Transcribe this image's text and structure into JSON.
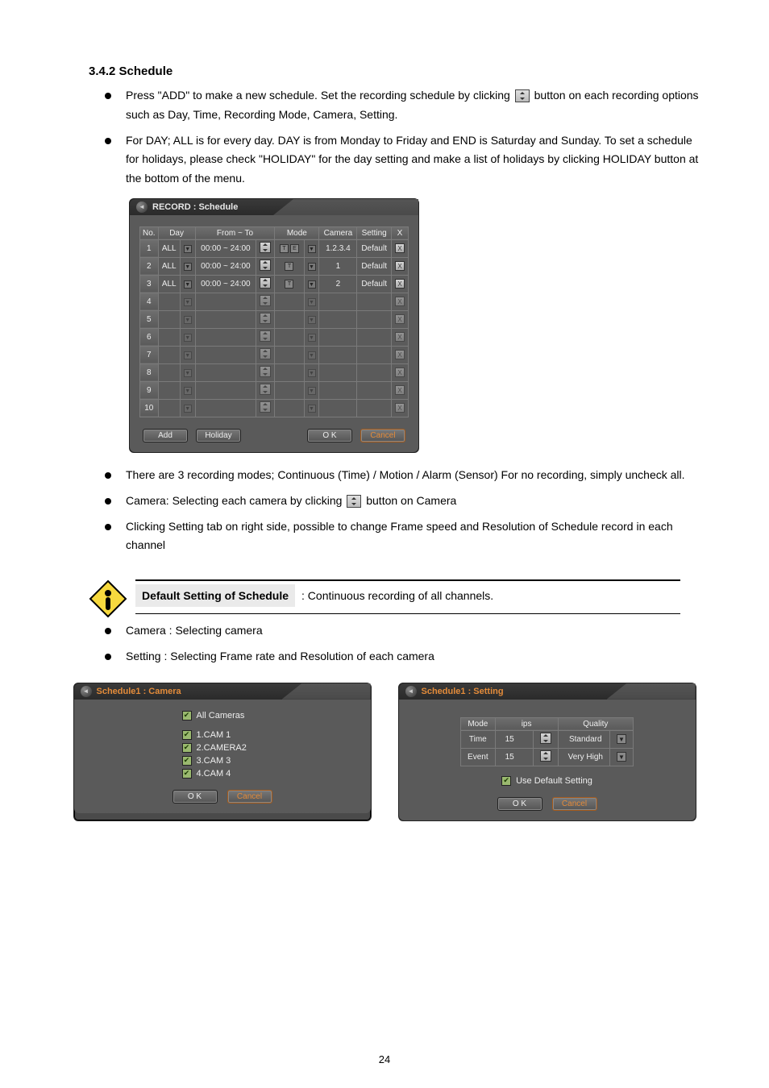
{
  "section": {
    "title": "3.4.2 Schedule",
    "intro_items": [
      {
        "before": "Press \"ADD\" to make a new schedule. Set the recording schedule by clicking ",
        "after": " button on each recording options such as Day, Time, Recording Mode, Camera, Setting."
      },
      {
        "text": "For DAY; ALL is for every day. DAY is from Monday to Friday and END is Saturday and Sunday. To set a schedule for holidays, please check \"HOLIDAY\" for the day setting and make a list of holidays by clicking HOLIDAY button at the bottom of the menu."
      }
    ],
    "after_items": [
      {
        "text": "There are 3 recording modes; Continuous (Time) / Motion / Alarm (Sensor) For no recording, simply uncheck all."
      },
      {
        "before": "Camera: Selecting each camera by clicking ",
        "after": " button on Camera"
      },
      {
        "text": "Clicking Setting tab on right side, possible to change Frame speed and Resolution of Schedule record in each channel"
      }
    ]
  },
  "schedule": {
    "title": "RECORD : Schedule",
    "headers": {
      "no": "No.",
      "day": "Day",
      "from_to": "From ~ To",
      "mode": "Mode",
      "camera": "Camera",
      "setting": "Setting",
      "x": "X"
    },
    "rows": [
      {
        "no": "1",
        "day": "ALL",
        "from_to": "00:00 ~ 24:00",
        "mode_icons": 2,
        "camera": "1.2.3.4",
        "setting": "Default"
      },
      {
        "no": "2",
        "day": "ALL",
        "from_to": "00:00 ~ 24:00",
        "mode_icons": 1,
        "camera": "1",
        "setting": "Default"
      },
      {
        "no": "3",
        "day": "ALL",
        "from_to": "00:00 ~ 24:00",
        "mode_icons": 1,
        "camera": "2",
        "setting": "Default"
      },
      {
        "no": "4"
      },
      {
        "no": "5"
      },
      {
        "no": "6"
      },
      {
        "no": "7"
      },
      {
        "no": "8"
      },
      {
        "no": "9"
      },
      {
        "no": "10"
      }
    ],
    "buttons": {
      "add": "Add",
      "holiday": "Holiday",
      "ok": "O K",
      "cancel": "Cancel"
    }
  },
  "note": {
    "heading": "Default Setting of Schedule",
    "body": ": Continuous recording of all channels.",
    "items": [
      "Camera : Selecting camera",
      "Setting : Selecting Frame rate and Resolution of each camera"
    ]
  },
  "camera_panel": {
    "title": "Schedule1 : Camera",
    "all": "All Cameras",
    "cams": [
      "1.CAM 1",
      "2.CAMERA2",
      "3.CAM 3",
      "4.CAM 4"
    ],
    "ok": "O K",
    "cancel": "Cancel"
  },
  "setting_panel": {
    "title": "Schedule1 : Setting",
    "headers": {
      "mode": "Mode",
      "ips": "ips",
      "quality": "Quality"
    },
    "rows": [
      {
        "mode": "Time",
        "ips": "15",
        "quality": "Standard"
      },
      {
        "mode": "Event",
        "ips": "15",
        "quality": "Very High"
      }
    ],
    "use_default": "Use Default Setting",
    "ok": "O K",
    "cancel": "Cancel"
  },
  "page_number": "24"
}
